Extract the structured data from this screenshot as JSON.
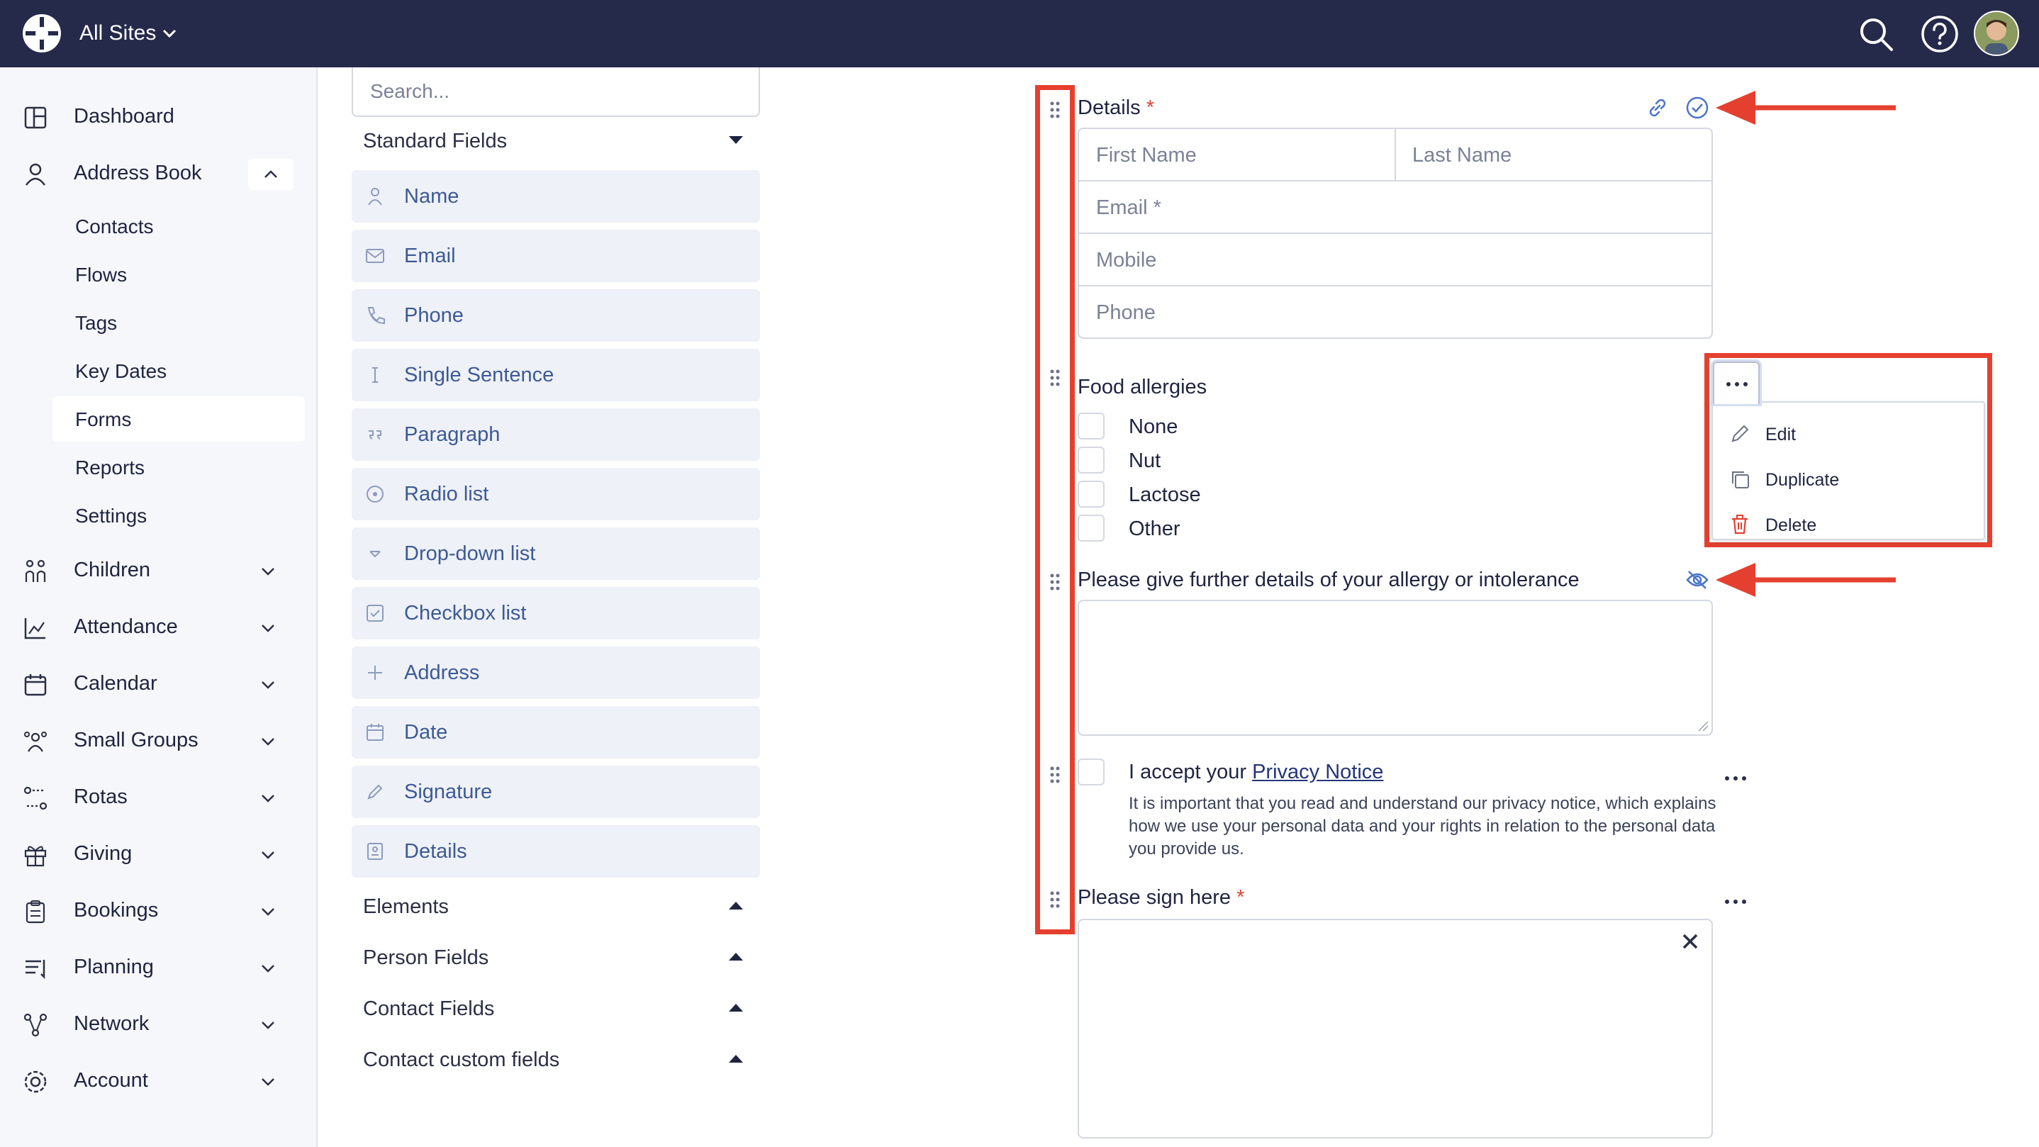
{
  "topbar": {
    "site_label": "All Sites"
  },
  "sidebar": {
    "items": [
      {
        "label": "Dashboard"
      },
      {
        "label": "Address Book"
      },
      {
        "label": "Children"
      },
      {
        "label": "Attendance"
      },
      {
        "label": "Calendar"
      },
      {
        "label": "Small Groups"
      },
      {
        "label": "Rotas"
      },
      {
        "label": "Giving"
      },
      {
        "label": "Bookings"
      },
      {
        "label": "Planning"
      },
      {
        "label": "Network"
      },
      {
        "label": "Account"
      }
    ],
    "address_book_sub": [
      {
        "label": "Contacts"
      },
      {
        "label": "Flows"
      },
      {
        "label": "Tags"
      },
      {
        "label": "Key Dates"
      },
      {
        "label": "Forms"
      },
      {
        "label": "Reports"
      },
      {
        "label": "Settings"
      }
    ]
  },
  "palette": {
    "search_placeholder": "Search...",
    "standard_fields_label": "Standard Fields",
    "fields": [
      {
        "label": "Name",
        "icon": "person-icon"
      },
      {
        "label": "Email",
        "icon": "envelope-icon"
      },
      {
        "label": "Phone",
        "icon": "phone-icon"
      },
      {
        "label": "Single Sentence",
        "icon": "text-cursor-icon"
      },
      {
        "label": "Paragraph",
        "icon": "quote-icon"
      },
      {
        "label": "Radio list",
        "icon": "radio-icon"
      },
      {
        "label": "Drop-down list",
        "icon": "dropdown-icon"
      },
      {
        "label": "Checkbox list",
        "icon": "checkbox-icon"
      },
      {
        "label": "Address",
        "icon": "plus-icon"
      },
      {
        "label": "Date",
        "icon": "calendar-icon"
      },
      {
        "label": "Signature",
        "icon": "pen-icon"
      },
      {
        "label": "Details",
        "icon": "id-card-icon"
      }
    ],
    "groups": [
      {
        "label": "Elements"
      },
      {
        "label": "Person Fields"
      },
      {
        "label": "Contact Fields"
      },
      {
        "label": "Contact custom fields"
      }
    ]
  },
  "form": {
    "details": {
      "title": "Details",
      "required_mark": "*",
      "first_name": "First Name",
      "last_name": "Last Name",
      "email": "Email *",
      "mobile": "Mobile",
      "phone": "Phone"
    },
    "allergies": {
      "title": "Food allergies",
      "options": [
        "None",
        "Nut",
        "Lactose",
        "Other"
      ]
    },
    "further_details": {
      "title": "Please give further details of your allergy or intolerance"
    },
    "privacy": {
      "prefix": "I accept your ",
      "link": "Privacy Notice",
      "description": "It is important that you read and understand our privacy notice, which explains how we use your personal data and your rights in relation to the personal data you provide us."
    },
    "signature": {
      "title": "Please sign here",
      "required_mark": "*",
      "clear_symbol": "✕"
    }
  },
  "menu": {
    "items": [
      {
        "label": "Edit"
      },
      {
        "label": "Duplicate"
      },
      {
        "label": "Delete"
      }
    ]
  },
  "colors": {
    "topbar": "#25294a",
    "annotation_red": "#e5402f",
    "field_label_blue": "#3d5a96",
    "link_blue": "#25357a"
  }
}
